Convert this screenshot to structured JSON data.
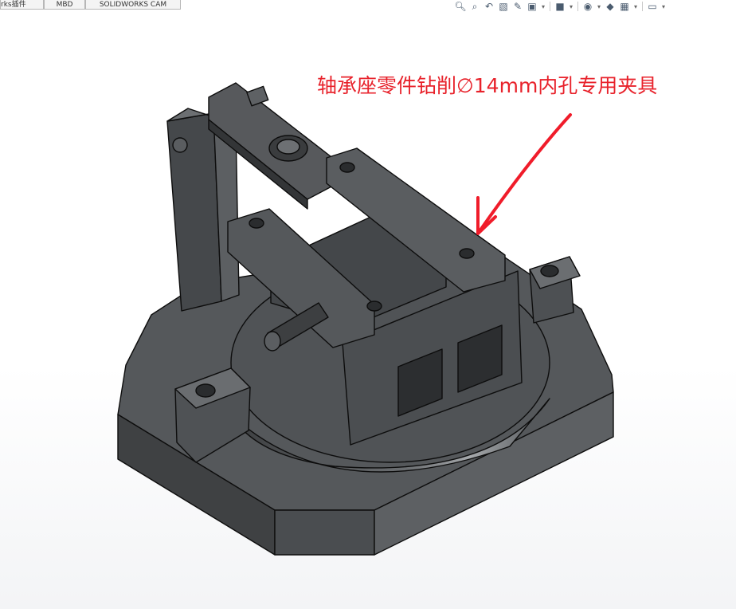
{
  "tabs": [
    {
      "label": "rks插件"
    },
    {
      "label": "MBD"
    },
    {
      "label": "SOLIDWORKS CAM"
    }
  ],
  "view_toolbar": {
    "icons": [
      "zoom-to-fit-icon",
      "zoom-area-icon",
      "previous-view-icon",
      "section-view-icon",
      "dynamic-annotation-icon",
      "view-orientation-icon",
      "dropdown",
      "display-style-icon",
      "dropdown",
      "hide-show-icon",
      "dropdown",
      "edit-appearance-icon",
      "apply-scene-icon",
      "dropdown",
      "view-settings-icon",
      "dropdown"
    ]
  },
  "annotation": {
    "text": "轴承座零件钻削∅14mm内孔专用夹具",
    "color": "#e8222b"
  },
  "colors": {
    "model_body": "#4e5154",
    "model_dark": "#2f3133",
    "model_light": "#6e7174",
    "edge": "#0d0d0d",
    "arrow": "#f01c2a"
  }
}
